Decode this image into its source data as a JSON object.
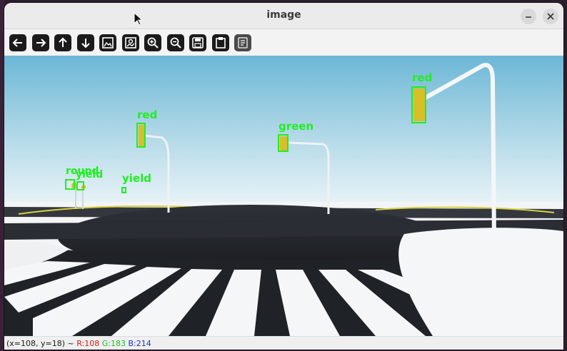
{
  "window": {
    "title": "image"
  },
  "toolbar": {
    "tools": [
      {
        "icon": "arrow-left-icon"
      },
      {
        "icon": "arrow-right-icon"
      },
      {
        "icon": "arrow-up-icon"
      },
      {
        "icon": "arrow-down-icon"
      },
      {
        "icon": "image-icon"
      },
      {
        "icon": "image-zoom-icon"
      },
      {
        "icon": "zoom-in-icon"
      },
      {
        "icon": "zoom-out-icon"
      },
      {
        "icon": "save-icon"
      },
      {
        "icon": "clipboard-icon"
      },
      {
        "icon": "properties-icon"
      }
    ]
  },
  "detections": [
    {
      "label": "red"
    },
    {
      "label": "green"
    },
    {
      "label": "red"
    },
    {
      "label": "yield"
    },
    {
      "label": "round"
    },
    {
      "label": "yield"
    }
  ],
  "status": {
    "coords": "(x=108, y=18) ~ ",
    "r": "R:108",
    "g": "G:183",
    "b": "B:214"
  },
  "colors": {
    "detection_box": "#22ee22",
    "sky_top": "#6cb7d6",
    "sky_bottom": "#e9f3f7"
  }
}
